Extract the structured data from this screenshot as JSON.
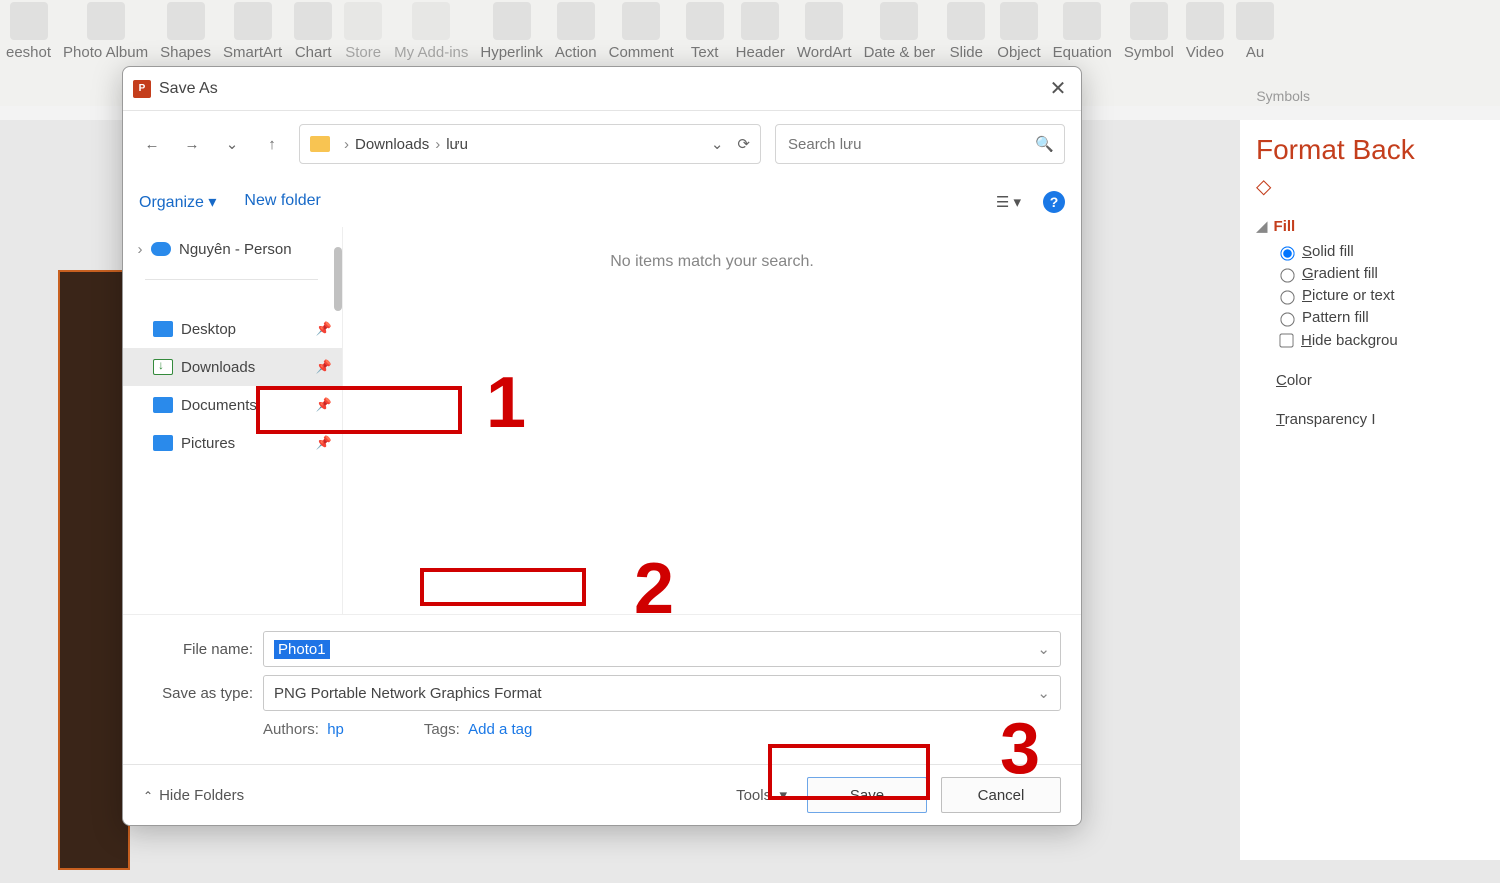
{
  "ribbon": {
    "buttons": [
      "eeshot",
      "Photo Album",
      "Shapes",
      "SmartArt",
      "Chart",
      "Store",
      "My Add-ins",
      "Hyperlink",
      "Action",
      "Comment",
      "Text",
      "Header",
      "WordArt",
      "Date & ber",
      "Slide",
      "Object",
      "Equation",
      "Symbol",
      "Video",
      "Au"
    ],
    "groups": {
      "symbols": "Symbols"
    }
  },
  "dialog": {
    "title": "Save As",
    "breadcrumb": {
      "root": "Downloads",
      "sub": "lưu"
    },
    "search_placeholder": "Search lưu",
    "organize": "Organize",
    "new_folder": "New folder",
    "tree": {
      "onedrive": "Nguyên - Person",
      "desktop": "Desktop",
      "downloads": "Downloads",
      "documents": "Documents",
      "pictures": "Pictures"
    },
    "empty_text": "No items match your search.",
    "filename_label": "File name:",
    "filename_value": "Photo1",
    "savetype_label": "Save as type:",
    "savetype_value": "PNG Portable Network Graphics Format",
    "authors_label": "Authors:",
    "authors_value": "hp",
    "tags_label": "Tags:",
    "tags_value": "Add a tag",
    "hide_folders": "Hide Folders",
    "tools": "Tools",
    "save": "Save",
    "cancel": "Cancel"
  },
  "format_pane": {
    "title": "Format Back",
    "section": "Fill",
    "options": {
      "solid": "olid fill",
      "gradient": "radient fill",
      "picture": "icture or text",
      "pattern": "Pattern fill",
      "hide": "ide backgrou"
    },
    "color_label": "olor",
    "transparency_label": "ransparency"
  },
  "annotations": {
    "n1": "1",
    "n2": "2",
    "n3": "3"
  }
}
